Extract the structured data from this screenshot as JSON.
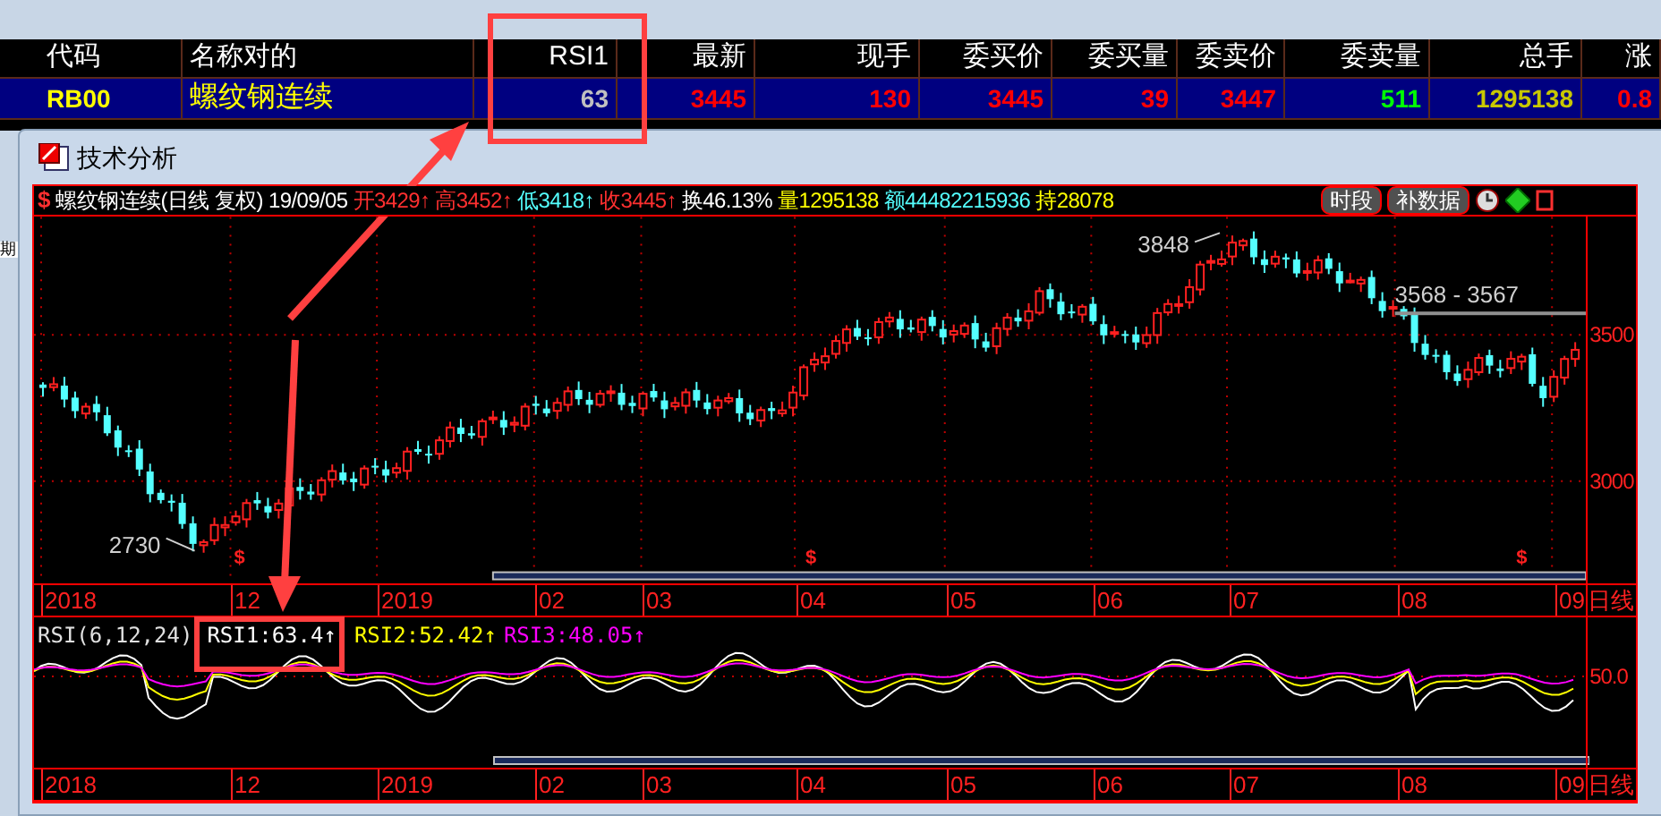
{
  "quote_table": {
    "columns": [
      "代码",
      "名称对的",
      "RSI1",
      "最新",
      "现手",
      "委买价",
      "委买量",
      "委卖价",
      "委卖量",
      "总手",
      "涨"
    ],
    "rows": [
      {
        "selected": true,
        "cells": [
          {
            "text": "RB00",
            "color": "#ffff00"
          },
          {
            "text": "螺纹钢连续",
            "color": "#ffff00"
          },
          {
            "text": "63",
            "color": "#c0c0c0"
          },
          {
            "text": "3445",
            "color": "#ff0000"
          },
          {
            "text": "130",
            "color": "#ff0000"
          },
          {
            "text": "3445",
            "color": "#ff0000"
          },
          {
            "text": "39",
            "color": "#ff0000"
          },
          {
            "text": "3447",
            "color": "#ff0000"
          },
          {
            "text": "511",
            "color": "#00ff00"
          },
          {
            "text": "1295138",
            "color": "#c8c800"
          },
          {
            "text": "0.8",
            "color": "#ff0000"
          }
        ]
      }
    ]
  },
  "side_strip": {
    "text": "期"
  },
  "window": {
    "title": "技术分析"
  },
  "info_bar": {
    "mark": "$",
    "fields": [
      {
        "text": "螺纹钢连续(日线 复权)",
        "color": "#ffffff"
      },
      {
        "text": "19/09/05",
        "color": "#ffffff"
      },
      {
        "text": "开3429↑",
        "color": "#ff3030"
      },
      {
        "text": "高3452↑",
        "color": "#ff3030"
      },
      {
        "text": "低3418↑",
        "color": "#54ffff"
      },
      {
        "text": "收3445↑",
        "color": "#ff3030"
      },
      {
        "text": "换46.13%",
        "color": "#ffffff"
      },
      {
        "text": "量1295138",
        "color": "#ffff00"
      },
      {
        "text": "额44482215936",
        "color": "#54ffff"
      },
      {
        "text": "持28078",
        "color": "#ffff00"
      }
    ],
    "buttons": [
      "时段",
      "补数据"
    ]
  },
  "price_chart": {
    "price_labels": [
      "3500",
      "3000"
    ],
    "annotations": [
      "3848",
      "2730",
      "3568 - 3567"
    ],
    "event_marks": [
      "$",
      "$",
      "$"
    ]
  },
  "x_axis": {
    "labels": [
      "2018",
      "12",
      "2019",
      "02",
      "03",
      "04",
      "05",
      "06",
      "07",
      "08",
      "09"
    ],
    "period": "日线"
  },
  "rsi_panel": {
    "title": "RSI(6,12,24)",
    "series": [
      {
        "text": "RSI1:63.4↑",
        "color": "#ffffff"
      },
      {
        "text": "RSI2:52.42↑",
        "color": "#ffff00"
      },
      {
        "text": "RSI3:48.05↑",
        "color": "#ff00ff"
      }
    ],
    "level_label": "50.0"
  },
  "x_axis_lower": {
    "labels": [
      "2018",
      "12",
      "2019",
      "02",
      "03",
      "04",
      "05",
      "06",
      "07",
      "08",
      "09"
    ],
    "period": "日线"
  }
}
